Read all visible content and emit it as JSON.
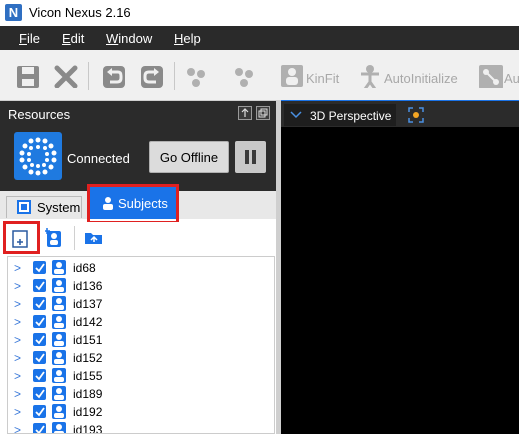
{
  "window": {
    "title": "Vicon Nexus 2.16",
    "logo_letter": "N"
  },
  "menu": {
    "items": [
      {
        "label": "File",
        "ul": "F"
      },
      {
        "label": "Edit",
        "ul": "E"
      },
      {
        "label": "Window",
        "ul": "W"
      },
      {
        "label": "Help",
        "ul": "H"
      }
    ]
  },
  "toolbar": {
    "kinfit_label": "KinFit",
    "autoinitialize_label": "AutoInitialize",
    "au_label": "Au"
  },
  "resources": {
    "title": "Resources",
    "status": "Connected",
    "go_offline_label": "Go Offline"
  },
  "tabs": {
    "system_label": "System",
    "subjects_label": "Subjects"
  },
  "subjects": {
    "items": [
      "id68",
      "id136",
      "id137",
      "id142",
      "id151",
      "id152",
      "id155",
      "id189",
      "id192",
      "id193"
    ]
  },
  "viewport": {
    "tab_label": "3D Perspective"
  },
  "colors": {
    "accent": "#1a73e8",
    "highlight": "#e02020",
    "dark": "#2b2b2b"
  }
}
